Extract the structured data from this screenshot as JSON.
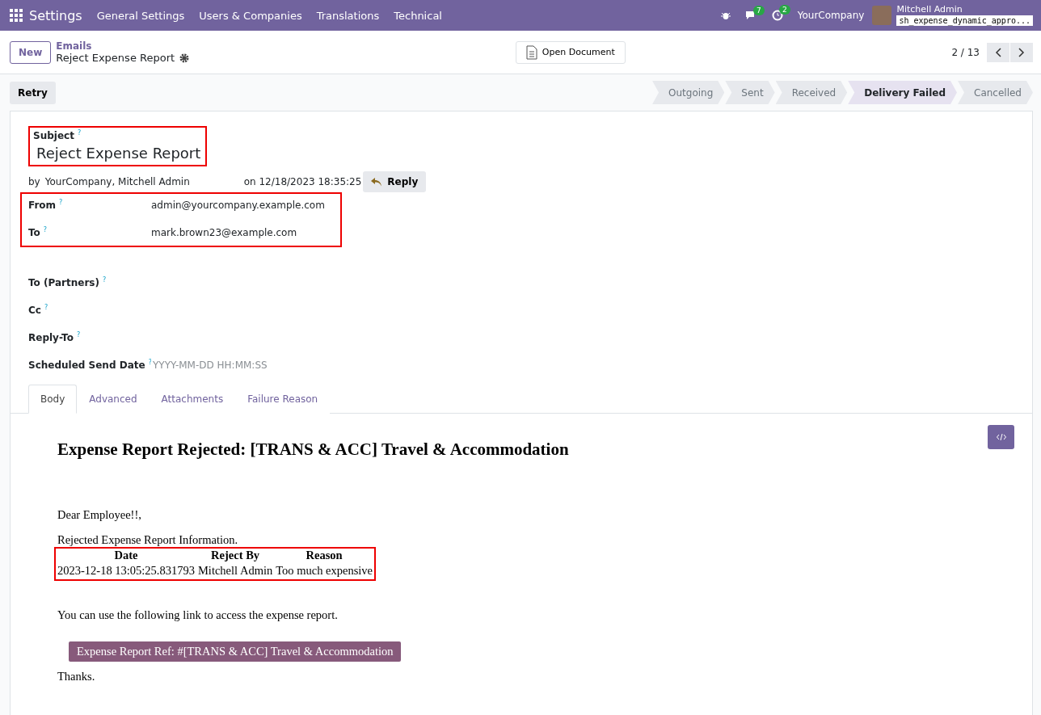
{
  "navbar": {
    "app": "Settings",
    "menus": [
      "General Settings",
      "Users & Companies",
      "Translations",
      "Technical"
    ],
    "chat_count": "7",
    "activity_count": "2",
    "company": "YourCompany",
    "user": "Mitchell Admin",
    "database": "sh_expense_dynamic_appro..."
  },
  "control_panel": {
    "new_button": "New",
    "breadcrumb": "Emails",
    "record": "Reject Expense Report",
    "open_document": "Open Document",
    "pager": "2 / 13"
  },
  "actions": {
    "retry": "Retry"
  },
  "stages": [
    {
      "label": "Outgoing",
      "selected": false
    },
    {
      "label": "Sent",
      "selected": false
    },
    {
      "label": "Received",
      "selected": false
    },
    {
      "label": "Delivery Failed",
      "selected": true
    },
    {
      "label": "Cancelled",
      "selected": false
    }
  ],
  "subject": {
    "label": "Subject",
    "help": "?",
    "value": "Reject Expense Report",
    "highlighted": true
  },
  "meta": {
    "by": "by",
    "author": "YourCompany, Mitchell Admin",
    "date": "on 12/18/2023 18:35:25",
    "reply": "Reply"
  },
  "addresses": {
    "highlighted": true,
    "fields": [
      {
        "label": "From",
        "help": "?",
        "value": "admin@yourcompany.example.com"
      },
      {
        "label": "To",
        "help": "?",
        "value": "mark.brown23@example.com"
      }
    ]
  },
  "fields": [
    {
      "label": "To (Partners)",
      "help": "?"
    },
    {
      "label": "Cc",
      "help": "?"
    },
    {
      "label": "Reply-To",
      "help": "?"
    },
    {
      "label": "Scheduled Send Date",
      "help": "?",
      "placeholder": "YYYY-MM-DD HH:MM:SS"
    }
  ],
  "tabs": [
    {
      "label": "Body",
      "selected": true
    },
    {
      "label": "Advanced",
      "selected": false
    },
    {
      "label": "Attachments",
      "selected": false
    },
    {
      "label": "Failure Reason",
      "selected": false
    }
  ],
  "body": {
    "heading": "Expense Report Rejected: [TRANS & ACC] Travel & Accommodation",
    "greeting": "Dear Employee!!,",
    "intro": "Rejected Expense Report Information.",
    "table": {
      "highlighted": true,
      "columns": [
        "Date",
        "Reject By",
        "Reason"
      ],
      "rows": [
        [
          "2023-12-18 13:05:25.831793",
          "Mitchell Admin",
          "Too much expensive"
        ]
      ]
    },
    "link_text": "You can use the following link to access the expense report.",
    "link_button": "Expense Report Ref: #[TRANS & ACC] Travel & Accommodation",
    "closing": "Thanks."
  }
}
